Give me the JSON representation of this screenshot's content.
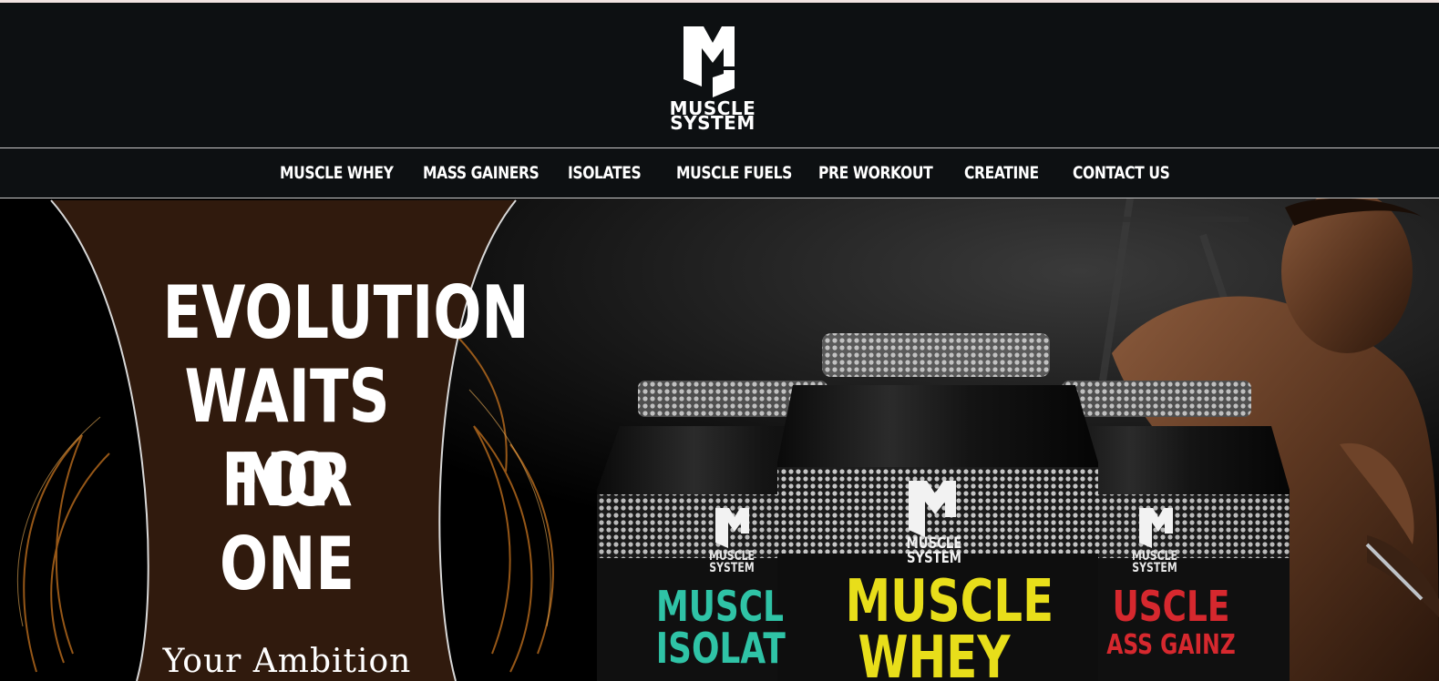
{
  "brand": {
    "line1": "MUSCLE",
    "line2": "SYSTEM",
    "mark": "MS"
  },
  "nav": {
    "items": [
      {
        "label": "MUSCLE WHEY"
      },
      {
        "label": "MASS GAINERS"
      },
      {
        "label": "ISOLATES"
      },
      {
        "label": "MUSCLE FUELS"
      },
      {
        "label": "PRE WORKOUT"
      },
      {
        "label": "CREATINE"
      },
      {
        "label": "CONTACT US"
      }
    ]
  },
  "hero": {
    "headline_lines": [
      "EVOLUTION",
      "WAITS FOR",
      "NO ONE"
    ],
    "tagline": "Your Ambition",
    "jars": [
      {
        "brand1": "MUSCLE",
        "brand2": "SYSTEM",
        "name1": "MUSCL",
        "name2": "ISOLAT"
      },
      {
        "brand1": "MUSCLE",
        "brand2": "SYSTEM",
        "name1": "MUSCLE",
        "name2": "WHEY"
      },
      {
        "brand1": "MUSCLE",
        "brand2": "SYSTEM",
        "name1": "USCLE",
        "name2": "ASS GAINZ"
      }
    ]
  },
  "colors": {
    "header_bg": "#0d1012",
    "banner_brown": "#301a0d",
    "isolate_teal": "#2fc3a6",
    "whey_yellow": "#e8de1a",
    "gainz_red": "#d6282e"
  }
}
